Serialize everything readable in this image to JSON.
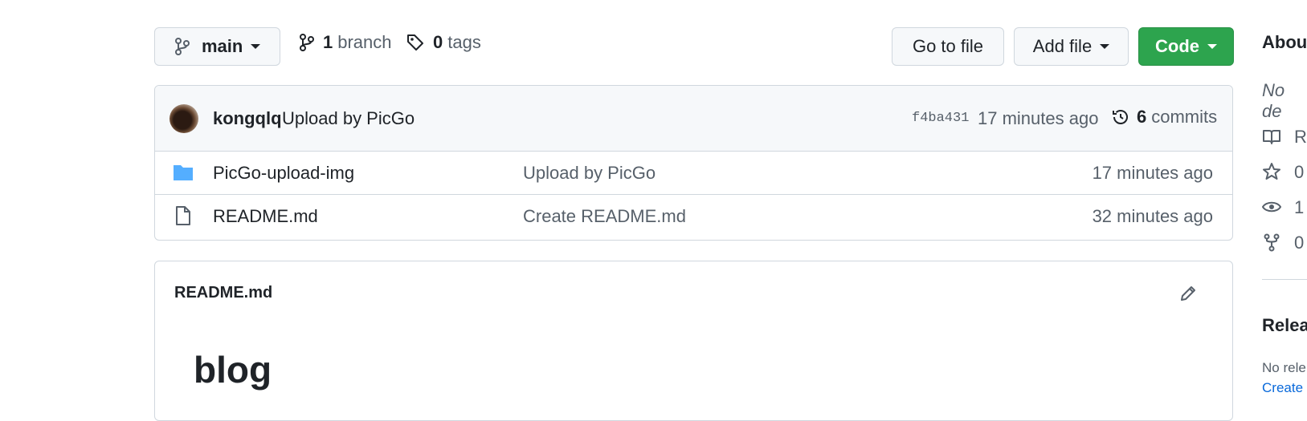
{
  "toolbar": {
    "branch_label": "main",
    "branches_count": "1",
    "branches_text": "branch",
    "tags_count": "0",
    "tags_text": "tags",
    "go_to_file": "Go to file",
    "add_file": "Add file",
    "code": "Code"
  },
  "commit": {
    "author": "kongqlq",
    "message": "Upload by PicGo",
    "sha": "f4ba431",
    "time": "17 minutes ago",
    "commits_count": "6",
    "commits_text": "commits"
  },
  "files": [
    {
      "name": "PicGo-upload-img",
      "message": "Upload by PicGo",
      "age": "17 minutes ago",
      "type": "folder"
    },
    {
      "name": "README.md",
      "message": "Create README.md",
      "age": "32 minutes ago",
      "type": "file"
    }
  ],
  "readme": {
    "filename": "README.md",
    "heading": "blog"
  },
  "sidebar": {
    "about_title": "Abou",
    "description": "No de",
    "readme_label": "R",
    "stars": "0",
    "watchers": "1",
    "forks": "0",
    "releases_title": "Relea",
    "no_releases": "No rele",
    "create_link": "Create"
  },
  "colors": {
    "primary_green": "#2da44e",
    "folder_blue": "#54aeff",
    "link_blue": "#0969da"
  }
}
